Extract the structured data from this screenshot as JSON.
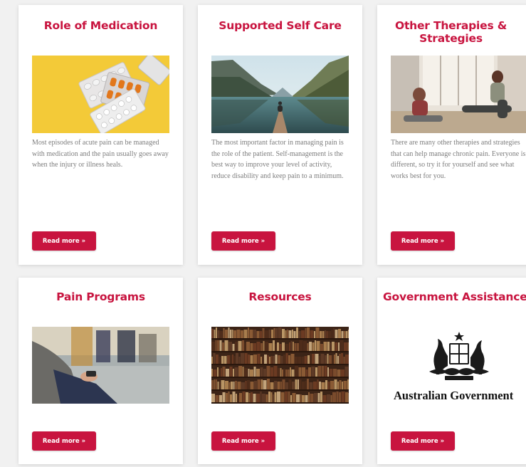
{
  "colors": {
    "accent": "#c8143f",
    "body_text": "#7d7d7d",
    "background": "#f1f1f1"
  },
  "cards": [
    {
      "title": "Role of Medication",
      "image": "pills-blister-pack-image",
      "text": "Most episodes of acute pain can be managed with medication and the pain usually goes away when the injury or illness heals.",
      "button": "Read more »"
    },
    {
      "title": "Supported Self Care",
      "image": "lake-meditation-image",
      "text": "The most important factor in managing pain is the role of the patient. Self-management is the best way to improve your level of activity, reduce disability and keep pain to a minimum.",
      "button": "Read more »"
    },
    {
      "title": "Other Therapies & Strategies",
      "image": "stretching-women-image",
      "text": "There are many other therapies and strategies that can help manage chronic pain. Everyone is different, so try it for yourself and see what works best for you.",
      "button": "Read more »"
    },
    {
      "title": "Pain Programs",
      "image": "group-session-image",
      "text": "",
      "button": "Read more »"
    },
    {
      "title": "Resources",
      "image": "bookshelves-image",
      "text": "",
      "button": "Read more »"
    },
    {
      "title": "Government Assistance",
      "image": "australian-government-logo",
      "logo_text": "Australian Government",
      "text": "",
      "button": "Read more »"
    }
  ]
}
